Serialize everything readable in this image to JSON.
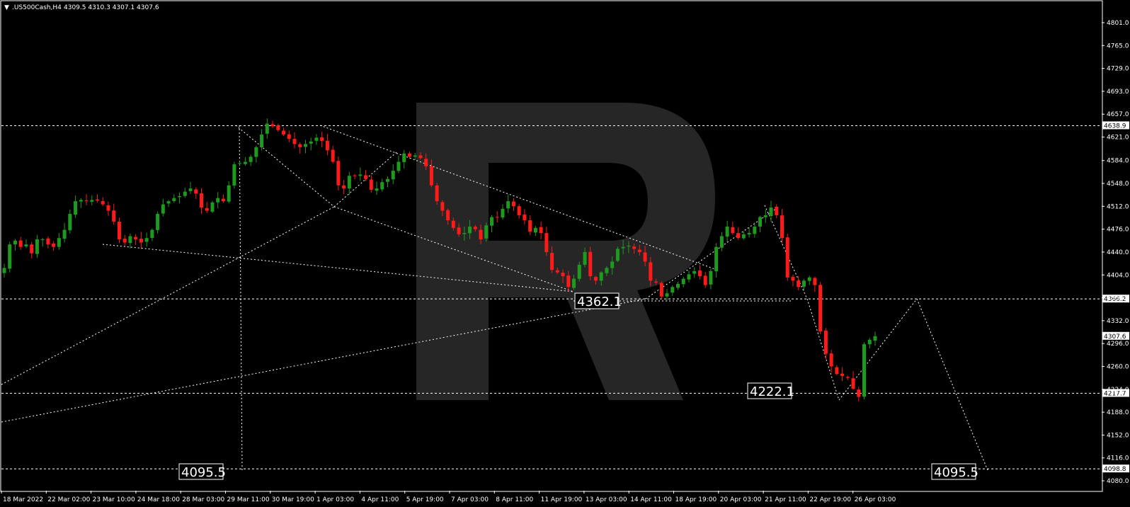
{
  "header": {
    "symbol": ".US500Cash,H4",
    "ohlc": "4309.5 4310.3 4307.1 4307.6"
  },
  "colors": {
    "background": "#000000",
    "bull": "#1e9b1e",
    "bear": "#ff1a1a",
    "grid": "#ffffff",
    "watermark": "#262626"
  },
  "chart_data": {
    "type": "candlestick",
    "ylim": [
      4080.0,
      4820.0
    ],
    "price_ticks": [
      "4801.0",
      "4765.0",
      "4729.0",
      "4693.0",
      "4657.0",
      "4621.0",
      "4584.0",
      "4548.0",
      "4512.0",
      "4476.0",
      "4440.0",
      "4404.0",
      "4368.0",
      "4332.0",
      "4296.0",
      "4260.0",
      "4224.0",
      "4188.0",
      "4152.0",
      "4116.0",
      "4080.0"
    ],
    "time_labels": [
      "18 Mar 2022",
      "22 Mar 02:00",
      "23 Mar 10:00",
      "24 Mar 18:00",
      "28 Mar 03:00",
      "29 Mar 11:00",
      "30 Mar 19:00",
      "1 Apr 03:00",
      "4 Apr 11:00",
      "5 Apr 19:00",
      "7 Apr 03:00",
      "8 Apr 11:00",
      "11 Apr 19:00",
      "13 Apr 03:00",
      "14 Apr 11:00",
      "18 Apr 19:00",
      "20 Apr 03:00",
      "21 Apr 11:00",
      "22 Apr 19:00",
      "26 Apr 03:00"
    ],
    "highlighted_levels": [
      {
        "price": 4638.9,
        "label": "4638.9"
      },
      {
        "price": 4366.2,
        "label": "4366.2"
      },
      {
        "price": 4307.6,
        "label": "4307.6"
      },
      {
        "price": 4217.7,
        "label": "4217.7"
      },
      {
        "price": 4098.8,
        "label": "4098.8"
      }
    ],
    "annotations": [
      {
        "label": "4362.1",
        "price": 4362.1
      },
      {
        "label": "4222.1",
        "price": 4222.1
      },
      {
        "label": "4095.5",
        "price": 4095.5
      },
      {
        "label": "4095.5",
        "price": 4095.5
      }
    ],
    "closes": [
      4415,
      4452,
      4458,
      4448,
      4452,
      4438,
      4460,
      4460,
      4452,
      4448,
      4462,
      4475,
      4500,
      4520,
      4522,
      4520,
      4522,
      4521,
      4515,
      4505,
      4488,
      4460,
      4455,
      4465,
      4460,
      4455,
      4462,
      4475,
      4500,
      4515,
      4520,
      4525,
      4528,
      4535,
      4540,
      4532,
      4510,
      4505,
      4518,
      4525,
      4520,
      4545,
      4578,
      4580,
      4582,
      4590,
      4605,
      4625,
      4642,
      4638,
      4632,
      4625,
      4618,
      4610,
      4605,
      4610,
      4614,
      4620,
      4615,
      4600,
      4582,
      4545,
      4540,
      4560,
      4560,
      4562,
      4555,
      4538,
      4540,
      4550,
      4555,
      4568,
      4582,
      4595,
      4590,
      4592,
      4588,
      4575,
      4545,
      4520,
      4505,
      4490,
      4478,
      4468,
      4470,
      4480,
      4476,
      4460,
      4482,
      4495,
      4495,
      4508,
      4520,
      4512,
      4498,
      4490,
      4472,
      4478,
      4470,
      4440,
      4412,
      4408,
      4402,
      4385,
      4398,
      4420,
      4440,
      4402,
      4395,
      4408,
      4415,
      4425,
      4445,
      4448,
      4450,
      4445,
      4440,
      4425,
      4395,
      4392,
      4370,
      4375,
      4385,
      4390,
      4398,
      4405,
      4410,
      4402,
      4388,
      4410,
      4448,
      4465,
      4480,
      4470,
      4462,
      4468,
      4470,
      4480,
      4495,
      4498,
      4510,
      4498,
      4462,
      4400,
      4395,
      4385,
      4395,
      4400,
      4388,
      4315,
      4280,
      4260,
      4248,
      4245,
      4242,
      4225,
      4212,
      4295,
      4302,
      4307.6
    ]
  }
}
